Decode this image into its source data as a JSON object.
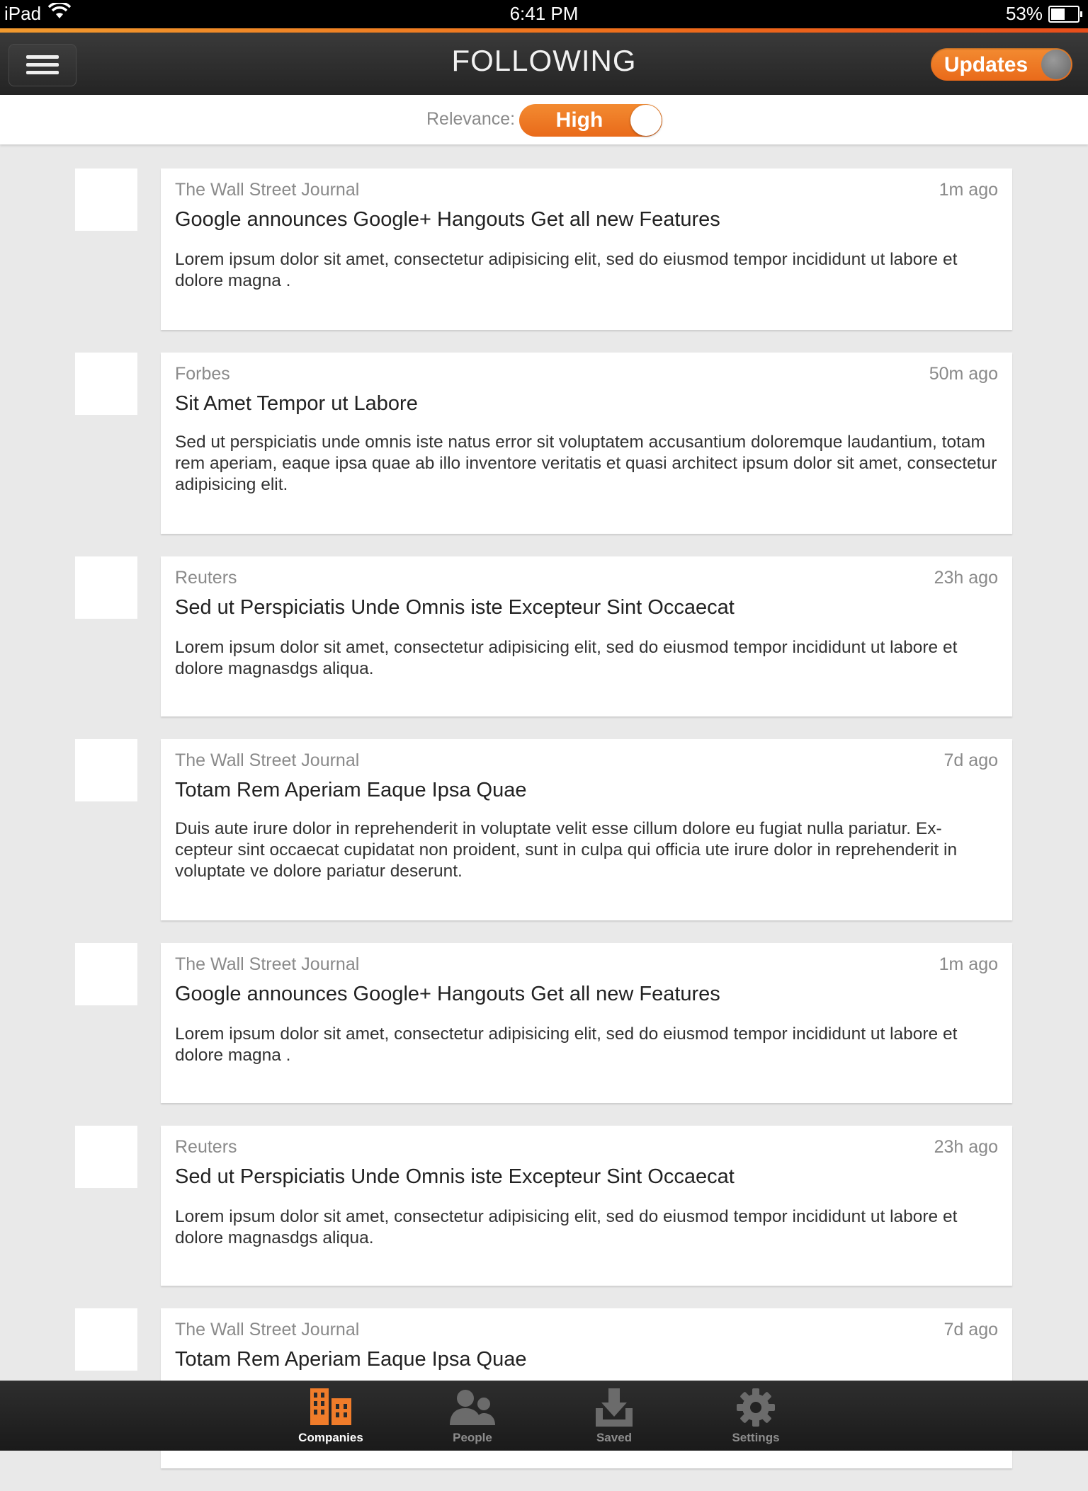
{
  "status_bar": {
    "device": "iPad",
    "time": "6:41 PM",
    "battery": "53%",
    "battery_level": 0.53
  },
  "header": {
    "title": "FOLLOWING",
    "updates_label": "Updates"
  },
  "relevance": {
    "label": "Relevance:",
    "value": "High"
  },
  "feed": [
    {
      "source": "The Wall Street Journal",
      "time": "1m ago",
      "title": "Google announces Google+ Hangouts Get all new Features",
      "summary": "Lorem ipsum dolor sit amet, consectetur adipisicing elit, sed do eiusmod tempor incididunt ut labore et dolore magna ."
    },
    {
      "source": "Forbes",
      "time": "50m ago",
      "title": "Sit Amet Tempor ut Labore",
      "summary": "Sed ut perspiciatis unde omnis iste natus error sit voluptatem accusantium doloremque laudantium, totam rem aperiam, eaque ipsa quae ab illo inventore veritatis et quasi architect ipsum dolor sit amet, consectetur adipisicing elit."
    },
    {
      "source": "Reuters",
      "time": "23h ago",
      "title": "Sed ut Perspiciatis Unde Omnis iste Excepteur Sint Occaecat",
      "summary": "Lorem ipsum dolor sit amet, consectetur adipisicing elit, sed do eiusmod tempor incididunt ut labore et dolore magnasdgs aliqua."
    },
    {
      "source": "The Wall Street Journal",
      "time": "7d ago",
      "title": "Totam Rem Aperiam Eaque Ipsa Quae",
      "summary": "Duis aute irure dolor in reprehenderit in voluptate velit esse cillum dolore eu fugiat nulla pariatur. Ex-cepteur sint occaecat cupidatat non proident, sunt in culpa qui officia ute irure dolor in reprehenderit in voluptate ve dolore pariatur deserunt."
    },
    {
      "source": "The Wall Street Journal",
      "time": "1m ago",
      "title": "Google announces Google+ Hangouts Get all new Features",
      "summary": "Lorem ipsum dolor sit amet, consectetur adipisicing elit, sed do eiusmod tempor incididunt ut labore et dolore magna ."
    },
    {
      "source": "Reuters",
      "time": "23h ago",
      "title": "Sed ut Perspiciatis Unde Omnis iste Excepteur Sint Occaecat",
      "summary": "Lorem ipsum dolor sit amet, consectetur adipisicing elit, sed do eiusmod tempor incididunt ut labore et dolore magnasdgs aliqua."
    },
    {
      "source": "The Wall Street Journal",
      "time": "7d ago",
      "title": "Totam Rem Aperiam Eaque Ipsa Quae",
      "summary": ""
    }
  ],
  "tabs": [
    {
      "label": "Companies",
      "icon": "buildings-icon",
      "active": true
    },
    {
      "label": "People",
      "icon": "people-icon",
      "active": false
    },
    {
      "label": "Saved",
      "icon": "download-tray-icon",
      "active": false
    },
    {
      "label": "Settings",
      "icon": "gear-icon",
      "active": false
    }
  ],
  "colors": {
    "accent": "#ef7a22",
    "tab_active": "#f07c2a",
    "tab_inactive": "#6b6b6b"
  }
}
